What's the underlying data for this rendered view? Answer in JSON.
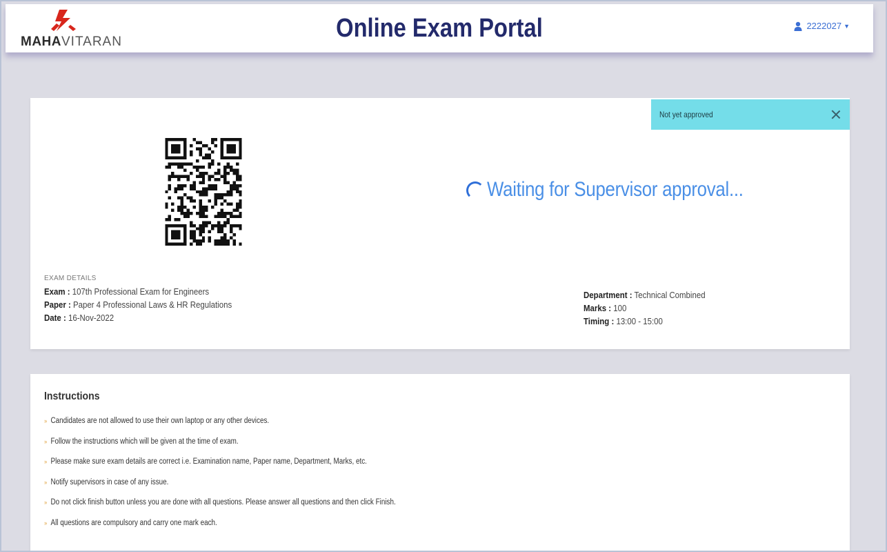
{
  "header": {
    "logo_bold": "MAHA",
    "logo_light": "VITARAN",
    "title": "Online Exam Portal",
    "user_id": "2222027",
    "user_icon": "user-icon",
    "caret_icon": "caret-down-icon"
  },
  "toast": {
    "message": "Not yet approved",
    "close_icon": "close-icon",
    "color": "#74dde9"
  },
  "status": {
    "waiting_text": "Waiting for Supervisor approval...",
    "spinner_icon": "spinner-icon",
    "color": "#4a8fe6"
  },
  "exam_details": {
    "section_label": "EXAM DETAILS",
    "left": [
      {
        "key": "Exam :",
        "value": " 107th Professional Exam for Engineers"
      },
      {
        "key": "Paper :",
        "value": " Paper 4 Professional Laws & HR Regulations"
      },
      {
        "key": "Date :",
        "value": " 16-Nov-2022"
      }
    ],
    "right": [
      {
        "key": "Department :",
        "value": " Technical Combined"
      },
      {
        "key": "Marks :",
        "value": " 100"
      },
      {
        "key": "Timing :",
        "value": " 13:00 - 15:00"
      }
    ]
  },
  "instructions": {
    "title": "Instructions",
    "bullet": "»",
    "items": [
      "Candidates are not allowed to use their own laptop or any other devices.",
      "Follow the instructions which will be given at the time of exam.",
      "Please make sure exam details are correct i.e. Examination name, Paper name, Department, Marks, etc.",
      "Notify supervisors in case of any issue.",
      "Do not click finish button unless you are done with all questions. Please answer all questions and then click Finish.",
      "All questions are compulsory and carry one mark each."
    ]
  },
  "colors": {
    "title": "#232a6b",
    "brand_red": "#d8261c",
    "link_blue": "#3b6fd4",
    "bullet": "#e0a341"
  }
}
